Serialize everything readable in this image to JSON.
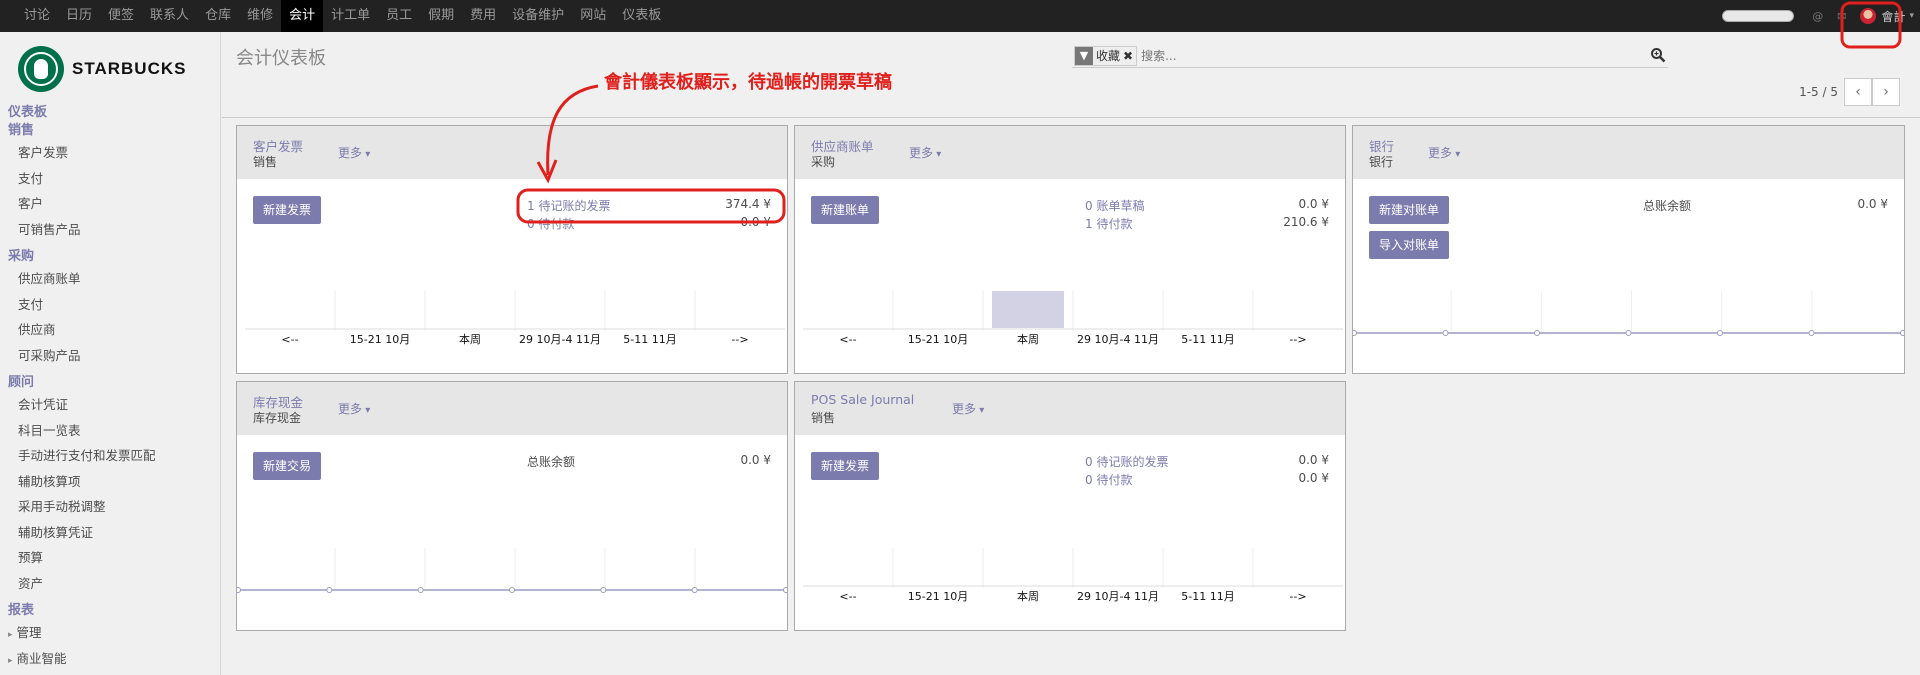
{
  "topmenu": [
    "讨论",
    "日历",
    "便签",
    "联系人",
    "仓库",
    "维修",
    "会计",
    "计工单",
    "员工",
    "假期",
    "费用",
    "设备维护",
    "网站",
    "仪表板"
  ],
  "topmenu_active": "会计",
  "user": {
    "name": "會計"
  },
  "brand": {
    "name": "STARBUCKS"
  },
  "sidebar": {
    "top_link": "仪表板",
    "sections": [
      {
        "title": "销售",
        "items": [
          "客户发票",
          "支付",
          "客户",
          "可销售产品"
        ]
      },
      {
        "title": "采购",
        "items": [
          "供应商账单",
          "支付",
          "供应商",
          "可采购产品"
        ]
      },
      {
        "title": "顾问",
        "items": [
          "会计凭证",
          "科目一览表",
          "手动进行支付和发票匹配",
          "辅助核算项",
          "采用手动税调整",
          "辅助核算凭证",
          "预算",
          "资产"
        ]
      },
      {
        "title": "报表",
        "items": [
          "管理",
          "商业智能"
        ]
      }
    ]
  },
  "page": {
    "title": "会计仪表板"
  },
  "search": {
    "facet_label": "收藏",
    "placeholder": "搜索..."
  },
  "pager": {
    "value": "1-5 / 5",
    "prev": "‹",
    "next": "›"
  },
  "annotation": {
    "text": "會計儀表板顯示，待過帳的開票草稿"
  },
  "cards": [
    {
      "title": "客户发票",
      "subtitle": "销售",
      "more": "更多",
      "buttons": [
        "新建发票"
      ],
      "stats": [
        {
          "label": "1 待记账的发票",
          "value": "374.4 ¥"
        },
        {
          "label": "0 待付款",
          "value": "0.0 ¥"
        }
      ],
      "graph": "ticks"
    },
    {
      "title": "供应商账单",
      "subtitle": "采购",
      "more": "更多",
      "buttons": [
        "新建账单"
      ],
      "stats": [
        {
          "label": "0 账单草稿",
          "value": "0.0 ¥"
        },
        {
          "label": "1 待付款",
          "value": "210.6 ¥"
        }
      ],
      "graph": "ticks-bar"
    },
    {
      "title": "银行",
      "subtitle": "银行",
      "more": "更多",
      "buttons": [
        "新建对账单",
        "导入对账单"
      ],
      "balance_label": "总账余额",
      "balance_value": "0.0 ¥",
      "graph": "line"
    },
    {
      "title": "库存现金",
      "subtitle": "库存现金",
      "more": "更多",
      "buttons": [
        "新建交易"
      ],
      "balance_label": "总账余额",
      "balance_value": "0.0 ¥",
      "graph": "line"
    },
    {
      "title": "POS Sale Journal",
      "subtitle": "销售",
      "more": "更多",
      "buttons": [
        "新建发票"
      ],
      "stats": [
        {
          "label": "0 待记账的发票",
          "value": "0.0 ¥"
        },
        {
          "label": "0 待付款",
          "value": "0.0 ¥"
        }
      ],
      "graph": "ticks"
    }
  ],
  "week_ticks": [
    "<--",
    "15-21 10月",
    "本周",
    "29 10月-4 11月",
    "5-11 11月",
    "-->"
  ],
  "colors": {
    "accent": "#7c7bad",
    "annotation": "#e0201c",
    "topbar": "#222222"
  }
}
